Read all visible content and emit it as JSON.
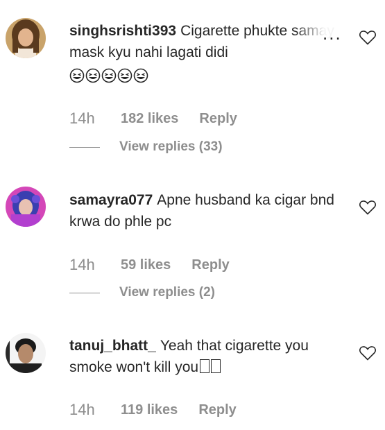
{
  "comments": [
    {
      "username": "singhsrishti393",
      "text": "Cigarette phukte samay mask kyu nahi lagati didi",
      "emoji_count": 5,
      "time": "14h",
      "likes": "182 likes",
      "reply": "Reply",
      "view_replies": "View replies (33)",
      "more_label": "..."
    },
    {
      "username": "samayra077",
      "text": "Apne husband ka cigar bnd krwa do phle pc",
      "time": "14h",
      "likes": "59 likes",
      "reply": "Reply",
      "view_replies": "View replies (2)"
    },
    {
      "username": "tanuj_bhatt_",
      "text": "Yeah that cigarette you smoke won't kill you",
      "box_glyph_count": 2,
      "time": "14h",
      "likes": "119 likes",
      "reply": "Reply"
    }
  ],
  "icons": {
    "heart": "heart-outline-icon",
    "emoji": "grinning-squinting-face-emoji",
    "more": "more-options-icon"
  },
  "colors": {
    "text": "#262626",
    "secondary": "#8e8e8e",
    "background": "#ffffff"
  }
}
